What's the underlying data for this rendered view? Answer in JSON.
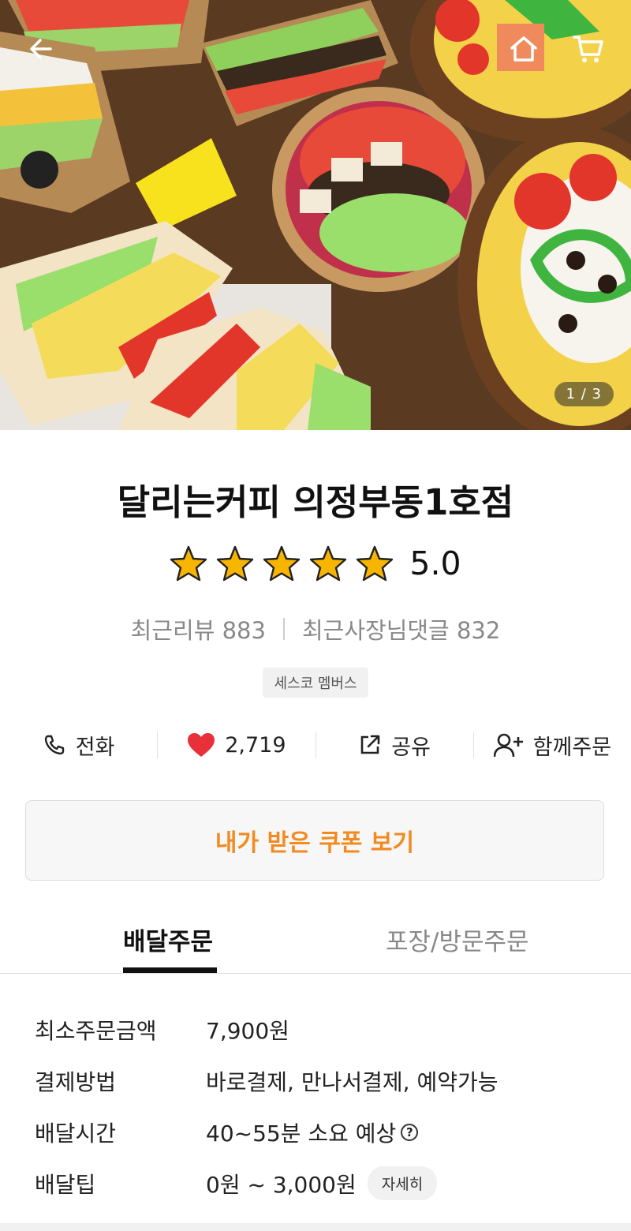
{
  "hero": {
    "pager": "1 / 3",
    "back_icon": "back-arrow-icon",
    "home_icon": "home-icon",
    "cart_icon": "cart-icon"
  },
  "store": {
    "name": "달리는커피 의정부동1호점",
    "rating": "5.0",
    "rating_value": 5,
    "recent_reviews_label": "최근리뷰 883",
    "owner_replies_label": "최근사장님댓글 832",
    "badge": "세스코 멤버스"
  },
  "actions": {
    "call": "전화",
    "likes": "2,719",
    "share": "공유",
    "group_order": "함께주문"
  },
  "coupon_button": "내가 받은 쿠폰 보기",
  "tabs": {
    "delivery": "배달주문",
    "pickup": "포장/방문주문"
  },
  "info": [
    {
      "key": "최소주문금액",
      "value": "7,900원"
    },
    {
      "key": "결제방법",
      "value": "바로결제, 만나서결제, 예약가능"
    },
    {
      "key": "배달시간",
      "value": "40~55분 소요 예상"
    },
    {
      "key": "배달팁",
      "value": "0원 ~ 3,000원",
      "detail": "자세히"
    }
  ],
  "colors": {
    "accent": "#f28a1e",
    "star": "#f7b500",
    "heart": "#e8303a"
  }
}
